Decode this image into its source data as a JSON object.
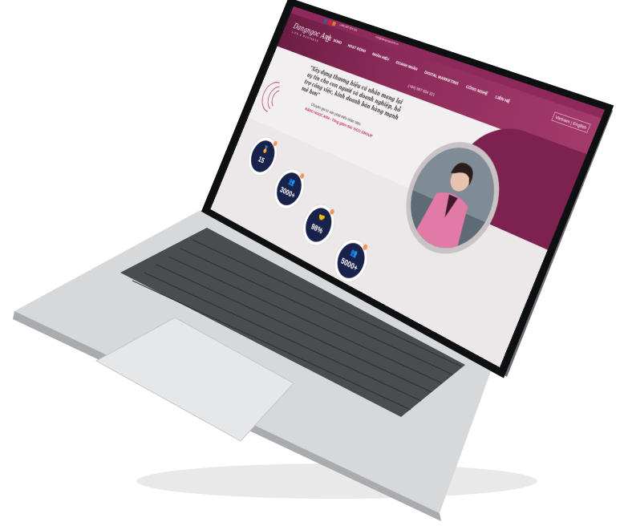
{
  "topbar": {
    "phone": "(+84) 987 654 321",
    "email": "info@dangngocanh.vn",
    "socials": [
      "facebook-icon",
      "youtube-icon",
      "instagram-icon"
    ]
  },
  "nav": {
    "logo": "Dangngoc Anh",
    "logo_sub": "LIFE & BUSINESS",
    "items": [
      "SỐNG",
      "HOẠT ĐỘNG",
      "NHÂN HIỆU",
      "DOANH NHÂN",
      "DIGITAL MARKETING",
      "CÔNG NGHỆ",
      "LIÊN HỆ"
    ],
    "phone": "(+84) 987 654 321",
    "language": "Vietnam | English"
  },
  "hero": {
    "quote": "\"Xây dựng thương hiệu cá nhân mang lại uy tín cho con người và doanh nghiệp, hỗ trợ công việc, kinh doanh bán hàng mạnh mẽ hơn\"",
    "expert_title": "Chuyên gia tư vấn phát triển nhân hiệu",
    "expert_name": "ĐẶNG NGỌC ANH - Tổng giám đốc VICO GROUP"
  },
  "stats": [
    {
      "icon": "medal-icon",
      "glyph": "🏅",
      "value": "15"
    },
    {
      "icon": "people-icon",
      "glyph": "👥",
      "value": "3000+"
    },
    {
      "icon": "handshake-icon",
      "glyph": "🤝",
      "value": "98%"
    },
    {
      "icon": "team-icon",
      "glyph": "👥",
      "value": "5000+"
    }
  ],
  "colors": {
    "brand": "#8e2a5b",
    "stat_circle": "#19224a",
    "accent_dot": "#f0965c"
  }
}
